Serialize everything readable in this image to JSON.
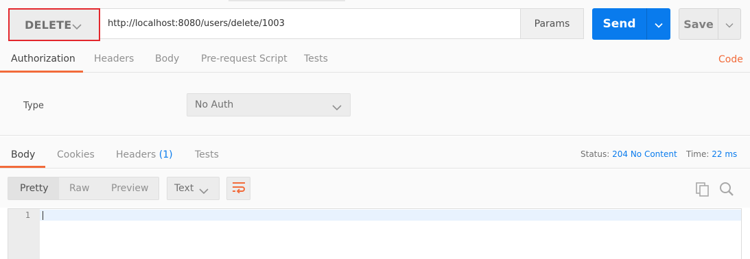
{
  "request": {
    "method": "DELETE",
    "url": "http://localhost:8080/users/delete/1003",
    "params_label": "Params",
    "send_label": "Send",
    "save_label": "Save"
  },
  "request_tabs": {
    "items": [
      {
        "label": "Authorization",
        "active": true
      },
      {
        "label": "Headers",
        "active": false
      },
      {
        "label": "Body",
        "active": false
      },
      {
        "label": "Pre-request Script",
        "active": false
      },
      {
        "label": "Tests",
        "active": false
      }
    ],
    "code_label": "Code"
  },
  "auth": {
    "type_label": "Type",
    "selected": "No Auth"
  },
  "response_tabs": {
    "body": "Body",
    "cookies": "Cookies",
    "headers": "Headers",
    "headers_count": "(1)",
    "tests": "Tests"
  },
  "response_status": {
    "status_label": "Status:",
    "status_value": "204 No Content",
    "time_label": "Time:",
    "time_value": "22 ms"
  },
  "format": {
    "pretty": "Pretty",
    "raw": "Raw",
    "preview": "Preview",
    "type_select": "Text"
  },
  "editor": {
    "line_numbers": [
      "1"
    ]
  },
  "colors": {
    "accent": "#f26b3a",
    "send_blue": "#097bed",
    "highlight_red": "#e3262c"
  },
  "icons": [
    "chevron-down-icon",
    "wrap-lines-icon",
    "copy-icon",
    "search-icon"
  ]
}
